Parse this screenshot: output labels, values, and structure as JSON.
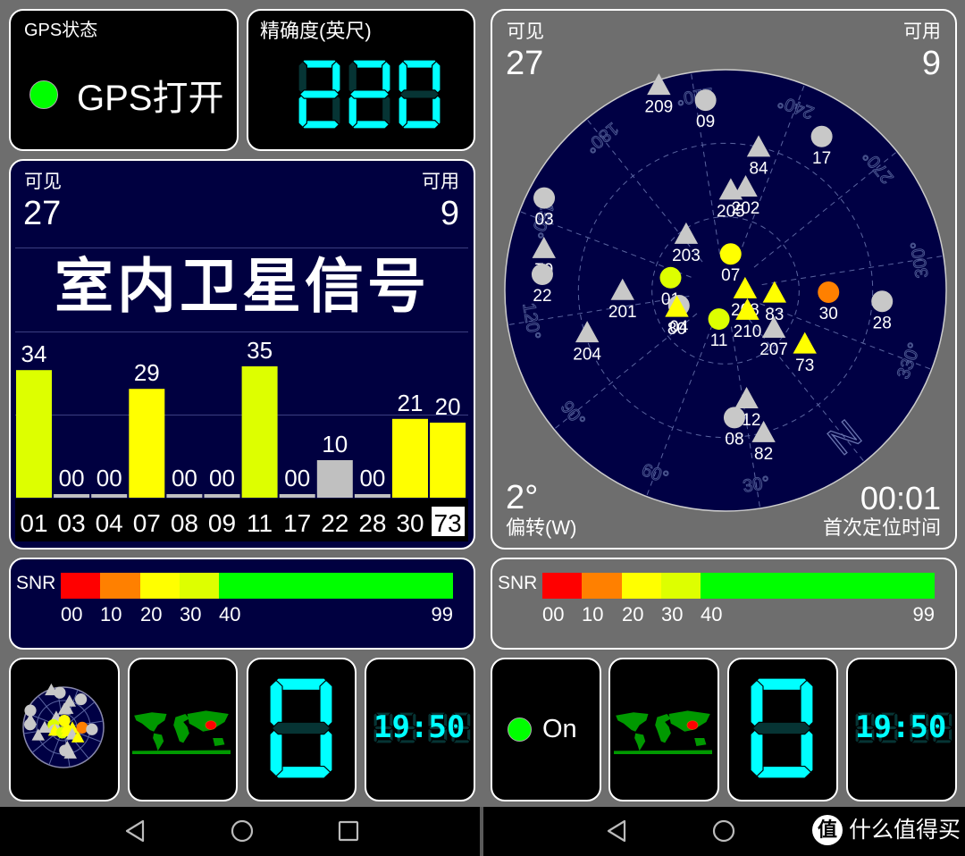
{
  "colors": {
    "background": "#6e6e6e",
    "panel_navy": "#000040",
    "segment_on": "#00ffff",
    "segment_off": "#063434",
    "gps_on": "#00ff00",
    "snr_scale": [
      "#ff0000",
      "#ff8000",
      "#ffff00",
      "#ddff00",
      "#00ff00"
    ],
    "sat_gray": "#c8c8c8",
    "map_land": "#009900",
    "location_dot": "#ff0000"
  },
  "left": {
    "gps_status": {
      "label": "GPS状态",
      "value": "GPS打开",
      "indicator": "green-dot-icon"
    },
    "accuracy": {
      "label": "精确度(英尺)",
      "value": "220"
    },
    "satellites": {
      "visible_label": "可见",
      "visible": "27",
      "used_label": "可用",
      "used": "9",
      "title": "室内卫星信号"
    },
    "chart_data": {
      "type": "bar",
      "categories": [
        "01",
        "03",
        "04",
        "07",
        "08",
        "09",
        "11",
        "17",
        "22",
        "28",
        "30",
        "73"
      ],
      "values": [
        34,
        0,
        0,
        29,
        0,
        0,
        35,
        0,
        10,
        0,
        21,
        20
      ],
      "value_labels": [
        "34",
        "00",
        "00",
        "29",
        "00",
        "00",
        "35",
        "00",
        "10",
        "00",
        "21",
        "20"
      ],
      "colors": [
        "#ddff00",
        "#c0c0c0",
        "#c0c0c0",
        "#ffff00",
        "#c0c0c0",
        "#c0c0c0",
        "#ddff00",
        "#c0c0c0",
        "#c0c0c0",
        "#c0c0c0",
        "#ffff00",
        "#ffff00"
      ],
      "selected": "73",
      "ylim": [
        0,
        40
      ],
      "title": "",
      "xlabel": "",
      "ylabel": ""
    },
    "snr": {
      "label": "SNR",
      "ticks": [
        "00",
        "10",
        "20",
        "30",
        "40",
        "99"
      ]
    },
    "tiles": {
      "digit": "0",
      "clock": "19:50"
    }
  },
  "right": {
    "sky": {
      "visible_label": "可见",
      "visible": "27",
      "used_label": "可用",
      "used": "9",
      "bearing": "2°",
      "bearing_label": "偏转(W)",
      "ttff": "00:01",
      "ttff_label": "首次定位时间",
      "north_label": "N",
      "azimuth_labels": [
        "30°",
        "60°",
        "90°",
        "120°",
        "150°",
        "180°",
        "210°",
        "240°",
        "270°",
        "300°",
        "330°"
      ],
      "satellites": [
        {
          "id": "209",
          "shape": "triangle",
          "color": "#c8c8c8",
          "az": 201,
          "el": 2
        },
        {
          "id": "09",
          "shape": "circle",
          "color": "#c8c8c8",
          "az": 213,
          "el": 12
        },
        {
          "id": "17",
          "shape": "circle",
          "color": "#c8c8c8",
          "az": 251,
          "el": 16
        },
        {
          "id": "84",
          "shape": "triangle",
          "color": "#c8c8c8",
          "az": 232,
          "el": 30
        },
        {
          "id": "205",
          "shape": "triangle",
          "color": "#c8c8c8",
          "az": 222,
          "el": 49
        },
        {
          "id": "202",
          "shape": "triangle",
          "color": "#c8c8c8",
          "az": 230,
          "el": 47
        },
        {
          "id": "03",
          "shape": "circle",
          "color": "#c8c8c8",
          "az": 156,
          "el": 7
        },
        {
          "id": "79",
          "shape": "triangle",
          "color": "#c8c8c8",
          "az": 142,
          "el": 14
        },
        {
          "id": "22",
          "shape": "circle",
          "color": "#c8c8c8",
          "az": 134,
          "el": 15
        },
        {
          "id": "203",
          "shape": "triangle",
          "color": "#c8c8c8",
          "az": 184,
          "el": 62
        },
        {
          "id": "07",
          "shape": "circle",
          "color": "#ffff00",
          "az": 227,
          "el": 75
        },
        {
          "id": "01",
          "shape": "circle",
          "color": "#ddff00",
          "az": 142,
          "el": 67
        },
        {
          "id": "04",
          "shape": "circle",
          "color": "#c8c8c8",
          "az": 111,
          "el": 70
        },
        {
          "id": "80",
          "shape": "triangle",
          "color": "#ffff00",
          "az": 110,
          "el": 69
        },
        {
          "id": "11",
          "shape": "circle",
          "color": "#ddff00",
          "az": 52,
          "el": 78
        },
        {
          "id": "208",
          "shape": "triangle",
          "color": "#ffff00",
          "az": 304,
          "el": 82
        },
        {
          "id": "210",
          "shape": "triangle",
          "color": "#ffff00",
          "az": 351,
          "el": 78
        },
        {
          "id": "83",
          "shape": "triangle",
          "color": "#ffff00",
          "az": 312,
          "el": 70
        },
        {
          "id": "207",
          "shape": "triangle",
          "color": "#c8c8c8",
          "az": 347,
          "el": 65
        },
        {
          "id": "73",
          "shape": "triangle",
          "color": "#ffff00",
          "az": 343,
          "el": 51
        },
        {
          "id": "30",
          "shape": "circle",
          "color": "#ff8000",
          "az": 310,
          "el": 48
        },
        {
          "id": "28",
          "shape": "circle",
          "color": "#c8c8c8",
          "az": 313,
          "el": 26
        },
        {
          "id": "201",
          "shape": "triangle",
          "color": "#c8c8c8",
          "az": 129,
          "el": 48
        },
        {
          "id": "204",
          "shape": "triangle",
          "color": "#c8c8c8",
          "az": 112,
          "el": 31
        },
        {
          "id": "212",
          "shape": "triangle",
          "color": "#c8c8c8",
          "az": 28,
          "el": 45
        },
        {
          "id": "08",
          "shape": "circle",
          "color": "#c8c8c8",
          "az": 35,
          "el": 38
        },
        {
          "id": "82",
          "shape": "triangle",
          "color": "#c8c8c8",
          "az": 24,
          "el": 30
        }
      ]
    },
    "snr": {
      "label": "SNR",
      "ticks": [
        "00",
        "10",
        "20",
        "30",
        "40",
        "99"
      ]
    },
    "tiles": {
      "gps_state": "On",
      "digit": "0",
      "clock": "19:50"
    }
  },
  "nav": {
    "left": [
      "back-icon",
      "home-icon",
      "recents-icon"
    ],
    "right": [
      "back-icon",
      "home-icon"
    ]
  },
  "watermark": {
    "logo_char": "值",
    "text": "什么值得买"
  }
}
